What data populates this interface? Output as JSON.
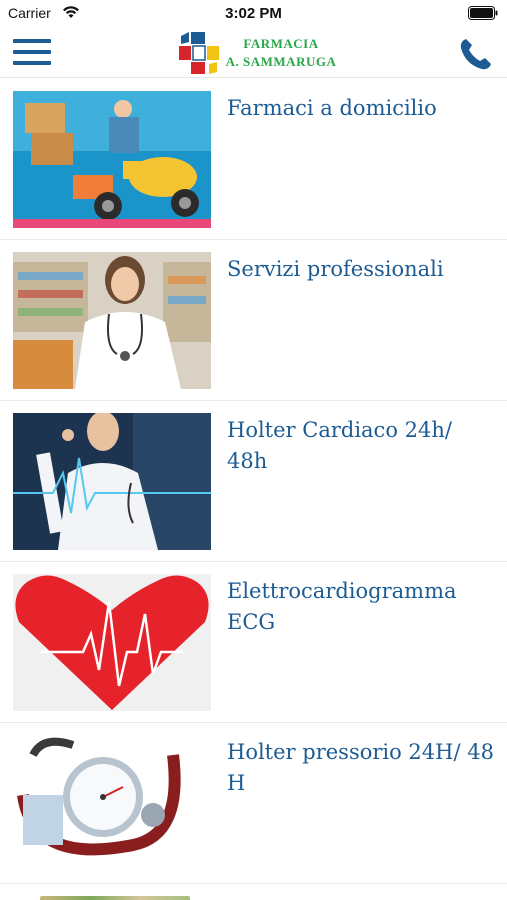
{
  "status_bar": {
    "carrier": "Carrier",
    "time": "3:02 PM"
  },
  "header": {
    "logo_line1": "FARMACIA",
    "logo_line2": "A. SAMMARUGA",
    "menu_icon": "hamburger-icon",
    "phone_icon": "phone-icon"
  },
  "colors": {
    "accent": "#1c5b93",
    "logo_green": "#2aa74a"
  },
  "items": [
    {
      "title": "Farmaci a domicilio",
      "image": "delivery-scooter-image"
    },
    {
      "title": "Servizi professionali",
      "image": "pharmacist-image"
    },
    {
      "title": "Holter Cardiaco 24h/ 48h",
      "image": "doctor-ecg-image"
    },
    {
      "title": "Elettrocardiogramma ECG",
      "image": "heart-ecg-image"
    },
    {
      "title": "Holter pressorio 24H/ 48 H",
      "image": "blood-pressure-gauge-image"
    }
  ]
}
